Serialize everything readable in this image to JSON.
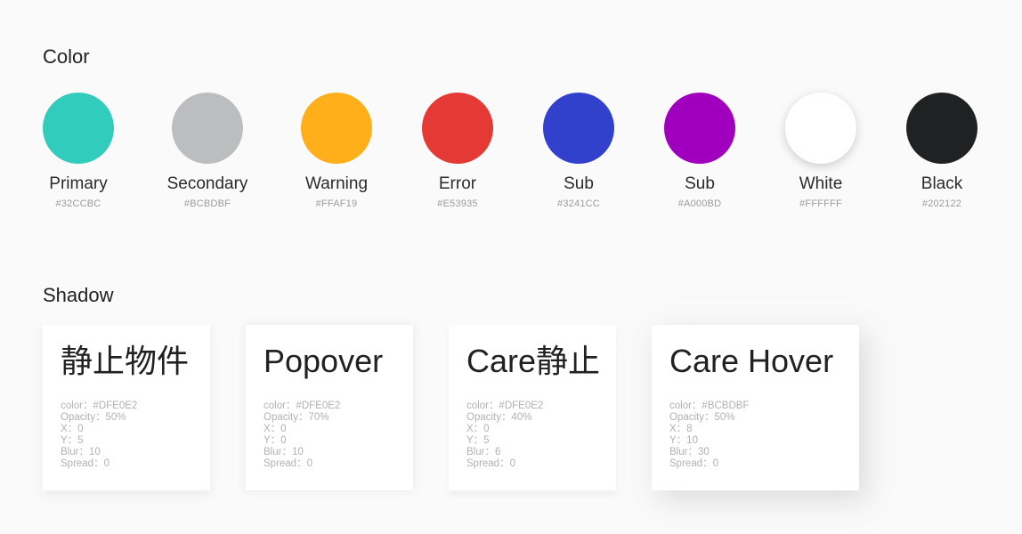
{
  "color_section": {
    "title": "Color",
    "swatches": [
      {
        "name": "Primary",
        "hex": "#32CCBC",
        "color": "#32CCBC"
      },
      {
        "name": "Secondary",
        "hex": "#BCBDBF",
        "color": "#BCBDBF"
      },
      {
        "name": "Warning",
        "hex": "#FFAF19",
        "color": "#FFAF19"
      },
      {
        "name": "Error",
        "hex": "#E53935",
        "color": "#E53935"
      },
      {
        "name": "Sub",
        "hex": "#3241CC",
        "color": "#3241CC"
      },
      {
        "name": "Sub",
        "hex": "#A000BD",
        "color": "#A000BD"
      },
      {
        "name": "White",
        "hex": "#FFFFFF",
        "color": "#FFFFFF"
      },
      {
        "name": "Black",
        "hex": "#202122",
        "color": "#202122"
      }
    ]
  },
  "shadow_section": {
    "title": "Shadow",
    "cards": [
      {
        "title": "静止物件",
        "color": "color：#DFE0E2",
        "opacity": "Opacity：50%",
        "x": "X：0",
        "y": "Y：5",
        "blur": "Blur：10",
        "spread": "Spread：0",
        "shadow_color": "#DFE0E2"
      },
      {
        "title": "Popover",
        "color": "color：#DFE0E2",
        "opacity": "Opacity：70%",
        "x": "X：0",
        "y": "Y：0",
        "blur": "Blur：10",
        "spread": "Spread：0",
        "shadow_color": "#DFE0E2"
      },
      {
        "title": "Care静止",
        "color": "color：#DFE0E2",
        "opacity": "Opacity：40%",
        "x": "X：0",
        "y": "Y：5",
        "blur": "Blur：6",
        "spread": "Spread：0",
        "shadow_color": "#DFE0E2"
      },
      {
        "title": "Care Hover",
        "color": "color：#BCBDBF",
        "opacity": "Opacity：50%",
        "x": "X：8",
        "y": "Y：10",
        "blur": "Blur：30",
        "spread": "Spread：0",
        "shadow_color": "#BCBDBF"
      }
    ]
  }
}
